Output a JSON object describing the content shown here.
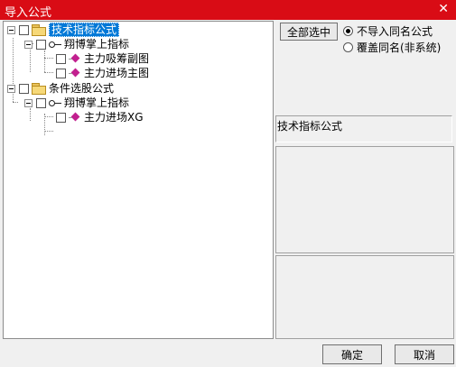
{
  "window": {
    "title": "导入公式",
    "close_glyph": "✕"
  },
  "tree": {
    "root1": {
      "label": "技术指标公式",
      "child": {
        "label": "翔博掌上指标",
        "leaves": [
          "主力吸筹副图",
          "主力进场主图"
        ]
      }
    },
    "root2": {
      "label": "条件选股公式",
      "child": {
        "label": "翔博掌上指标",
        "leaves": [
          "主力进场XG"
        ]
      }
    }
  },
  "controls": {
    "select_all": "全部选中",
    "options": [
      {
        "label": "不导入同名公式",
        "checked": true
      },
      {
        "label": "覆盖同名(非系统)",
        "checked": false
      }
    ]
  },
  "formula_type": "技术指标公式",
  "footer": {
    "ok": "确定",
    "cancel": "取消"
  },
  "colors": {
    "titlebar": "#d90c15",
    "selection": "#0078d7",
    "gem": "#c2208f",
    "folder": "#f6d878"
  }
}
